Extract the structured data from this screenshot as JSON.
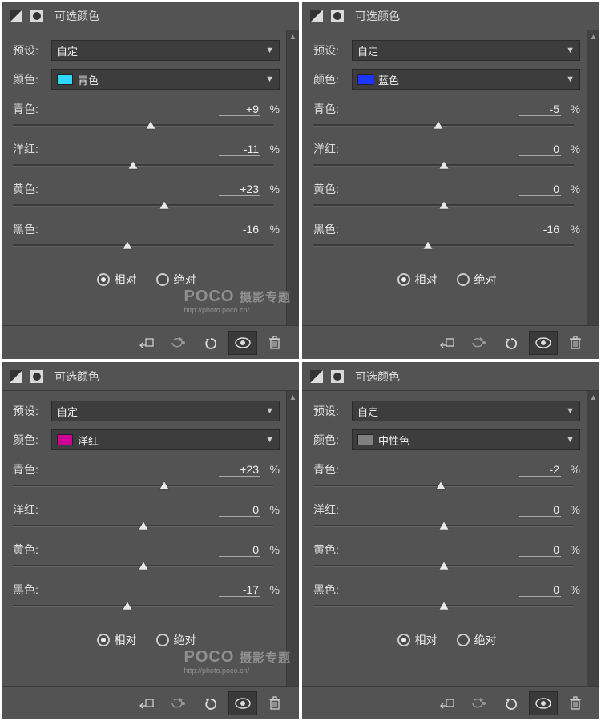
{
  "common": {
    "panel_title": "可选颜色",
    "preset_label": "预设:",
    "preset_value": "自定",
    "color_label": "颜色:",
    "unit": "%",
    "radio_relative": "相对",
    "radio_absolute": "绝对",
    "sliders": {
      "cyan": "青色:",
      "magenta": "洋红:",
      "yellow": "黄色:",
      "black": "黑色:"
    }
  },
  "watermark": {
    "brand": "POCO",
    "sub": "http://photo.poco.cn/",
    "tag": "摄影专题"
  },
  "panels": [
    {
      "color_name": "青色",
      "swatch": "#2fd7ff",
      "values": {
        "cyan": "+9",
        "magenta": "-11",
        "yellow": "+23",
        "black": "-16"
      },
      "thumbs": {
        "cyan": 53,
        "magenta": 46,
        "yellow": 58,
        "black": 44
      }
    },
    {
      "color_name": "蓝色",
      "swatch": "#1a36ff",
      "values": {
        "cyan": "-5",
        "magenta": "0",
        "yellow": "0",
        "black": "-16"
      },
      "thumbs": {
        "cyan": 48,
        "magenta": 50,
        "yellow": 50,
        "black": 44
      }
    },
    {
      "color_name": "洋红",
      "swatch": "#cc0099",
      "values": {
        "cyan": "+23",
        "magenta": "0",
        "yellow": "0",
        "black": "-17"
      },
      "thumbs": {
        "cyan": 58,
        "magenta": 50,
        "yellow": 50,
        "black": 44
      }
    },
    {
      "color_name": "中性色",
      "swatch": "#808080",
      "values": {
        "cyan": "-2",
        "magenta": "0",
        "yellow": "0",
        "black": "0"
      },
      "thumbs": {
        "cyan": 49,
        "magenta": 50,
        "yellow": 50,
        "black": 50
      }
    }
  ]
}
